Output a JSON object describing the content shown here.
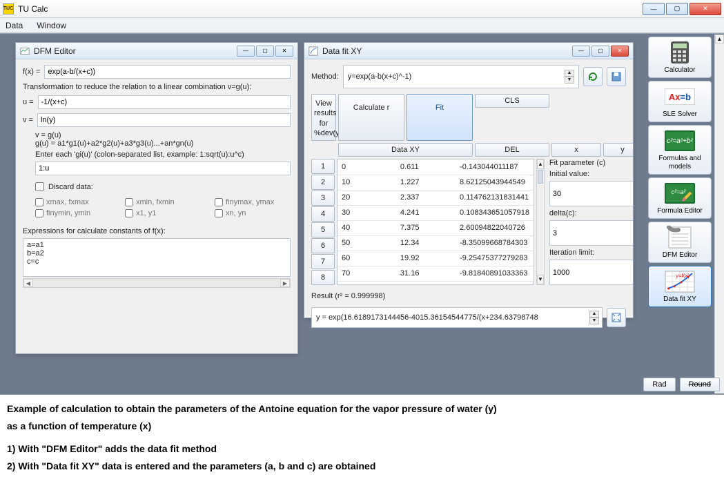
{
  "app": {
    "title": "TU Calc"
  },
  "menu": {
    "data": "Data",
    "window": "Window"
  },
  "window_controls": {
    "min": "—",
    "max": "▢",
    "close": "✕"
  },
  "dfm": {
    "title": "DFM Editor",
    "fx_label": "f(x) =",
    "fx_value": "exp(a-b/(x+c))",
    "trans_label": "Transformation to reduce the relation to a linear combination v=g(u):",
    "u_label": "u =",
    "u_value": "-1/(x+c)",
    "v_label": "v =",
    "v_value": "ln(y)",
    "g_heading_1": "v = g(u)",
    "g_heading_2": "g(u) = a1*g1(u)+a2*g2(u)+a3*g3(u)...+an*gn(u)",
    "g_heading_3": "Enter each 'gi(u)' (colon-separated list, example: 1:sqrt(u):u^c)",
    "gi_value": "1:u",
    "discard_label": "Discard data:",
    "checks": {
      "a": "xmax, fxmax",
      "b": "xmin, fxmin",
      "c": "finymax, ymax",
      "d": "finymin, ymin",
      "e": "x1, y1",
      "f": "xn, yn"
    },
    "const_label": "Expressions for calculate constants of f(x):",
    "constants": "a=a1\nb=a2\nc=c"
  },
  "dfx": {
    "title": "Data fit XY",
    "method_label": "Method:",
    "method_value": "y=exp(a-b(x+c)^-1)",
    "btn_cls": "CLS",
    "btn_del": "DEL",
    "btn_dataxy": "Data XY",
    "btn_x": "x",
    "btn_y": "y",
    "btn_view": "View results for %dev(y)",
    "btn_calc": "Calculate r",
    "btn_fit": "Fit",
    "fit_param_label": "Fit parameter (c)",
    "initial_label": "Initial value:",
    "initial_value": "30",
    "delta_label": "delta(c):",
    "delta_value": "3",
    "iter_label": "Iteration limit:",
    "iter_value": "1000",
    "result_label": "Result (r² = 0.999998)",
    "result_value": "y = exp(16.6189173144456-4015.36154544775/(x+234.63798748",
    "rows": [
      {
        "n": "1",
        "x": "0",
        "y": "0.611",
        "dev": "-0.143044011187"
      },
      {
        "n": "2",
        "x": "10",
        "y": "1.227",
        "dev": "8.62125043944549"
      },
      {
        "n": "3",
        "x": "20",
        "y": "2.337",
        "dev": "0.114762131831441"
      },
      {
        "n": "4",
        "x": "30",
        "y": "4.241",
        "dev": "0.108343651057918"
      },
      {
        "n": "5",
        "x": "40",
        "y": "7.375",
        "dev": "2.60094822040726"
      },
      {
        "n": "6",
        "x": "50",
        "y": "12.34",
        "dev": "-8.35099668784303"
      },
      {
        "n": "7",
        "x": "60",
        "y": "19.92",
        "dev": "-9.25475377279283"
      },
      {
        "n": "8",
        "x": "70",
        "y": "31.16",
        "dev": "-9.81840891033363"
      }
    ]
  },
  "sidebar": {
    "calc": "Calculator",
    "sle": "SLE Solver",
    "formulas": "Formulas and models",
    "fed": "Formula Editor",
    "dfm": "DFM Editor",
    "dfx": "Data fit XY"
  },
  "footer": {
    "rad": "Rad",
    "round": "Round"
  },
  "caption": {
    "l1": "Example of calculation to obtain the parameters of the Antoine equation for the vapor pressure of water (y)",
    "l2": "as a function of temperature (x)",
    "l3": "1) With \"DFM Editor\" adds the data fit method",
    "l4": "2) With \"Data fit XY\" data is entered and the parameters (a, b and c) are obtained"
  }
}
